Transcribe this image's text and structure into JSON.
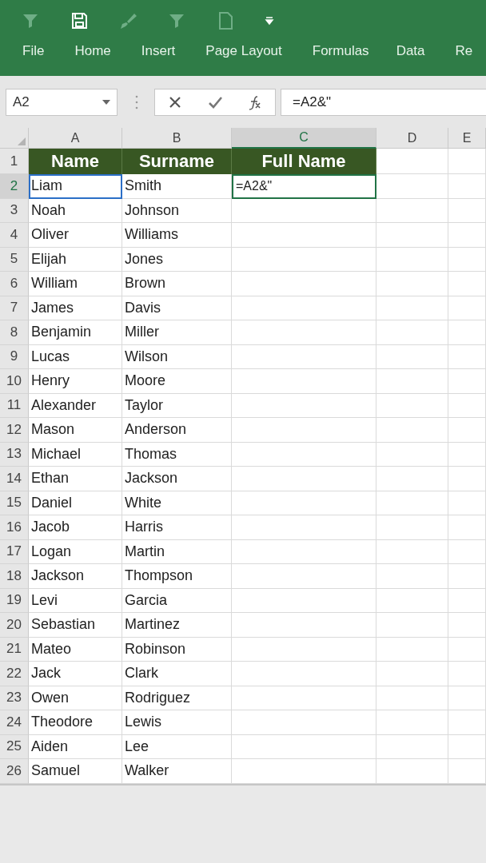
{
  "ribbon": {
    "tabs": [
      {
        "label": "File"
      },
      {
        "label": "Home"
      },
      {
        "label": "Insert"
      },
      {
        "label": "Page Layout"
      },
      {
        "label": "Formulas"
      },
      {
        "label": "Data"
      },
      {
        "label": "Re"
      }
    ]
  },
  "formula_bar": {
    "name_box": "A2",
    "formula": "=A2&\""
  },
  "sheet": {
    "columns": [
      {
        "label": "A",
        "selected": false
      },
      {
        "label": "B",
        "selected": false
      },
      {
        "label": "C",
        "selected": true
      },
      {
        "label": "D",
        "selected": false
      },
      {
        "label": "E",
        "selected": false
      }
    ],
    "header_row": {
      "number": "1",
      "cells": [
        "Name",
        "Surname",
        "Full Name"
      ]
    },
    "rows": [
      {
        "number": "2",
        "name": "Liam",
        "surname": "Smith",
        "full_name": "=A2&\"",
        "selected": true,
        "referenced": true
      },
      {
        "number": "3",
        "name": "Noah",
        "surname": "Johnson",
        "selected": false,
        "referenced": false
      },
      {
        "number": "4",
        "name": "Oliver",
        "surname": "Williams",
        "selected": false,
        "referenced": false
      },
      {
        "number": "5",
        "name": "Elijah",
        "surname": "Jones",
        "selected": false,
        "referenced": false
      },
      {
        "number": "6",
        "name": "William",
        "surname": "Brown",
        "selected": false,
        "referenced": false
      },
      {
        "number": "7",
        "name": "James",
        "surname": "Davis",
        "selected": false,
        "referenced": false
      },
      {
        "number": "8",
        "name": "Benjamin",
        "surname": "Miller",
        "selected": false,
        "referenced": false
      },
      {
        "number": "9",
        "name": "Lucas",
        "surname": "Wilson",
        "selected": false,
        "referenced": false
      },
      {
        "number": "10",
        "name": "Henry",
        "surname": "Moore",
        "selected": false,
        "referenced": false
      },
      {
        "number": "11",
        "name": "Alexander",
        "surname": "Taylor",
        "selected": false,
        "referenced": false
      },
      {
        "number": "12",
        "name": "Mason",
        "surname": "Anderson",
        "selected": false,
        "referenced": false
      },
      {
        "number": "13",
        "name": "Michael",
        "surname": "Thomas",
        "selected": false,
        "referenced": false
      },
      {
        "number": "14",
        "name": "Ethan",
        "surname": "Jackson",
        "selected": false,
        "referenced": false
      },
      {
        "number": "15",
        "name": "Daniel",
        "surname": "White",
        "selected": false,
        "referenced": false
      },
      {
        "number": "16",
        "name": "Jacob",
        "surname": "Harris",
        "selected": false,
        "referenced": false
      },
      {
        "number": "17",
        "name": "Logan",
        "surname": "Martin",
        "selected": false,
        "referenced": false
      },
      {
        "number": "18",
        "name": "Jackson",
        "surname": "Thompson",
        "selected": false,
        "referenced": false
      },
      {
        "number": "19",
        "name": "Levi",
        "surname": "Garcia",
        "selected": false,
        "referenced": false
      },
      {
        "number": "20",
        "name": "Sebastian",
        "surname": "Martinez",
        "selected": false,
        "referenced": false
      },
      {
        "number": "21",
        "name": "Mateo",
        "surname": "Robinson",
        "selected": false,
        "referenced": false
      },
      {
        "number": "22",
        "name": "Jack",
        "surname": "Clark",
        "selected": false,
        "referenced": false
      },
      {
        "number": "23",
        "name": "Owen",
        "surname": "Rodriguez",
        "selected": false,
        "referenced": false
      },
      {
        "number": "24",
        "name": "Theodore",
        "surname": "Lewis",
        "selected": false,
        "referenced": false
      },
      {
        "number": "25",
        "name": "Aiden",
        "surname": "Lee",
        "selected": false,
        "referenced": false
      },
      {
        "number": "26",
        "name": "Samuel",
        "surname": "Walker",
        "selected": false,
        "referenced": false
      }
    ]
  }
}
